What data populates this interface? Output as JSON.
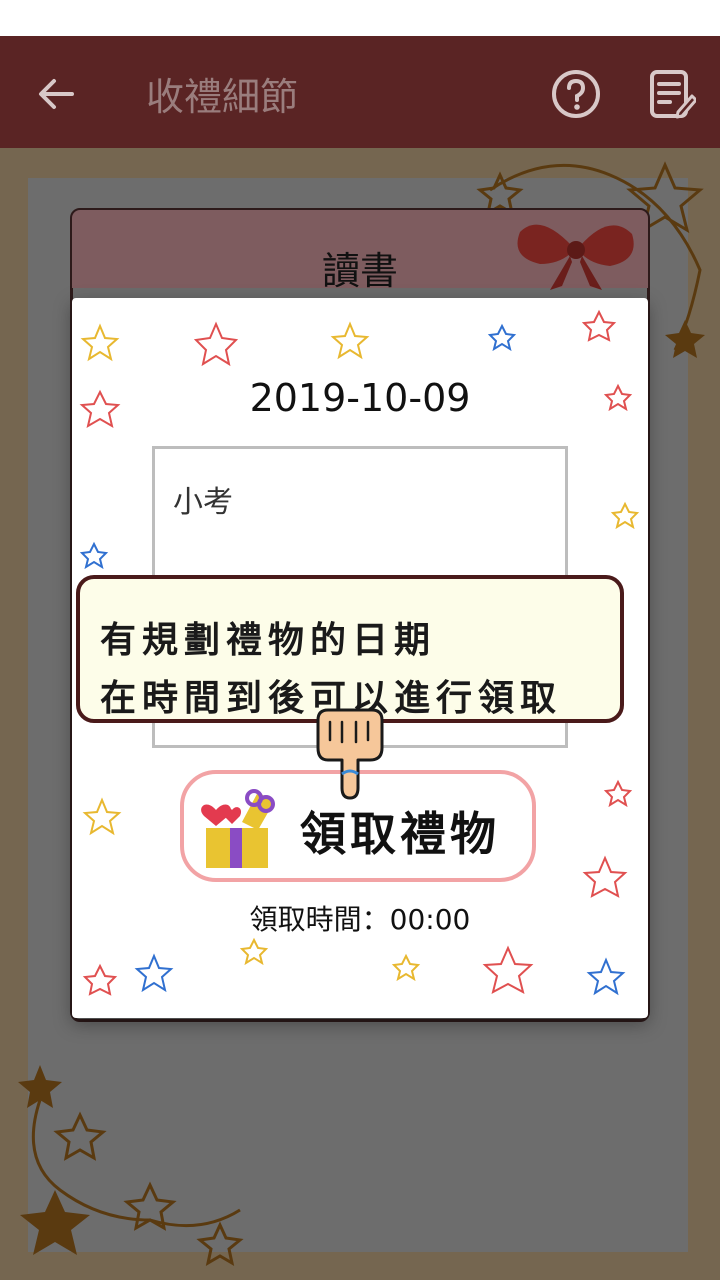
{
  "app_bar": {
    "title": "收禮細節",
    "back_icon": "arrow-left-icon",
    "help_icon": "help-circle-icon",
    "edit_icon": "edit-note-icon"
  },
  "card": {
    "title": "讀書"
  },
  "dialog": {
    "date": "2019-10-09",
    "note": "小考",
    "claim_button_label": "領取禮物",
    "claim_time": "領取時間：00:00"
  },
  "tooltip": {
    "line1": "有規劃禮物的日期",
    "line2": "在時間到後可以進行領取"
  },
  "colors": {
    "app_bar": "#5a2424",
    "claim_border": "#f2a3a5",
    "tooltip_bg": "#fdfde9",
    "tooltip_border": "#4a1a1a"
  }
}
